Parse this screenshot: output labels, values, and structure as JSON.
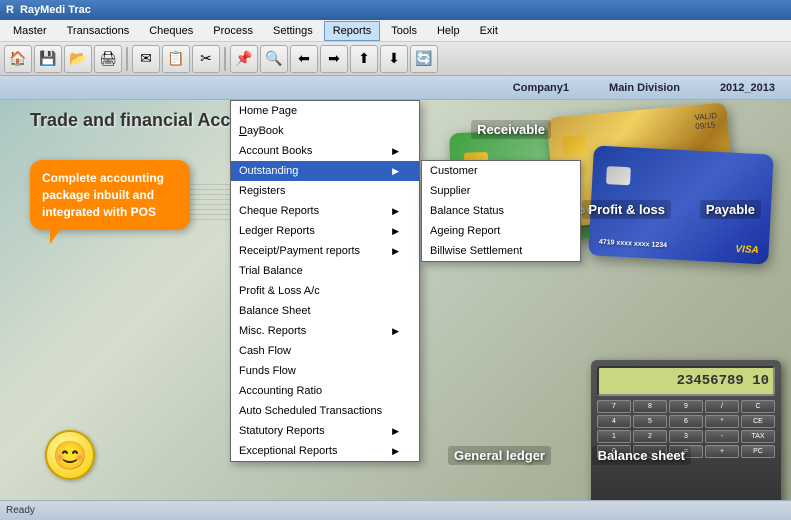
{
  "app": {
    "title": "RayMedi Trac",
    "icon": "R"
  },
  "company_bar": {
    "company": "Company1",
    "division": "Main Division",
    "year": "2012_2013"
  },
  "menu_bar": {
    "items": [
      {
        "label": "Master",
        "id": "master"
      },
      {
        "label": "Transactions",
        "id": "transactions"
      },
      {
        "label": "Cheques",
        "id": "cheques"
      },
      {
        "label": "Process",
        "id": "process"
      },
      {
        "label": "Settings",
        "id": "settings"
      },
      {
        "label": "Reports",
        "id": "reports",
        "active": true
      },
      {
        "label": "Tools",
        "id": "tools"
      },
      {
        "label": "Help",
        "id": "help"
      },
      {
        "label": "Exit",
        "id": "exit"
      }
    ]
  },
  "reports_menu": {
    "items": [
      {
        "label": "Home Page",
        "id": "home-page",
        "has_arrow": false
      },
      {
        "label": "DayBook",
        "id": "daybook",
        "underline_char": "D",
        "has_arrow": false
      },
      {
        "label": "Account Books",
        "id": "account-books",
        "has_arrow": true
      },
      {
        "label": "Outstanding",
        "id": "outstanding",
        "has_arrow": true,
        "highlighted": true
      },
      {
        "label": "Registers",
        "id": "registers",
        "has_arrow": false
      },
      {
        "label": "Cheque Reports",
        "id": "cheque-reports",
        "has_arrow": true
      },
      {
        "label": "Ledger Reports",
        "id": "ledger-reports",
        "has_arrow": true
      },
      {
        "label": "Receipt/Payment reports",
        "id": "receipt-payment",
        "has_arrow": true
      },
      {
        "label": "Trial Balance",
        "id": "trial-balance",
        "has_arrow": false
      },
      {
        "label": "Profit & Loss A/c",
        "id": "profit-loss",
        "has_arrow": false
      },
      {
        "label": "Balance Sheet",
        "id": "balance-sheet",
        "has_arrow": false
      },
      {
        "label": "Misc. Reports",
        "id": "misc-reports",
        "has_arrow": true
      },
      {
        "label": "Cash Flow",
        "id": "cash-flow",
        "has_arrow": false
      },
      {
        "label": "Funds Flow",
        "id": "funds-flow",
        "has_arrow": false
      },
      {
        "label": "Accounting Ratio",
        "id": "accounting-ratio",
        "has_arrow": false
      },
      {
        "label": "Auto Scheduled Transactions",
        "id": "auto-scheduled",
        "has_arrow": false
      },
      {
        "label": "Statutory Reports",
        "id": "statutory-reports",
        "has_arrow": true
      },
      {
        "label": "Exceptional Reports",
        "id": "exceptional-reports",
        "has_arrow": true
      }
    ]
  },
  "outstanding_submenu": {
    "items": [
      {
        "label": "Customer",
        "id": "customer"
      },
      {
        "label": "Supplier",
        "id": "supplier"
      },
      {
        "label": "Balance Status",
        "id": "balance-status"
      },
      {
        "label": "Ageing Report",
        "id": "ageing-report"
      },
      {
        "label": "Billwise Settlement",
        "id": "billwise-settlement"
      }
    ]
  },
  "main": {
    "heading": "Trade and financial Acc",
    "callout": "Complete accounting package inbuilt and integrated with POS"
  },
  "bg_labels": {
    "receivable": "Receivable",
    "profit_loss": "Profit & loss",
    "payable": "Payable",
    "general_ledger": "General ledger",
    "balance_sheet": "Balance sheet"
  },
  "calculator": {
    "display": "23456789 10",
    "buttons": [
      "7",
      "8",
      "9",
      "/",
      "C",
      "4",
      "5",
      "6",
      "*",
      "CE",
      "1",
      "2",
      "3",
      "-",
      "TAX",
      "0",
      ".",
      "=",
      "+",
      "PC"
    ]
  },
  "toolbar": {
    "buttons": [
      "🏠",
      "💾",
      "📂",
      "🖨",
      "✉",
      "📋",
      "✂",
      "📌",
      "🔍",
      "⬅",
      "➡",
      "⬆",
      "⬇",
      "🔄"
    ]
  },
  "nav": {
    "buttons": [
      "Master",
      "Transactions",
      "Cheques",
      "Process",
      "Settings",
      "Reports",
      "Tools",
      "Help"
    ]
  }
}
